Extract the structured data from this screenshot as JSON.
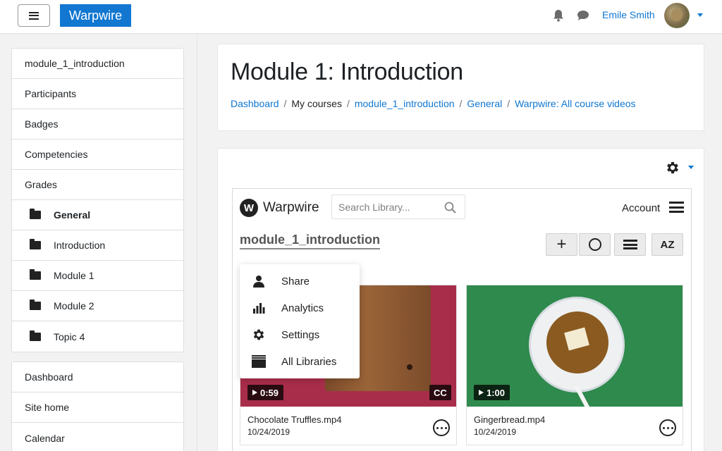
{
  "navbar": {
    "brand": "Warpwire",
    "user_name": "Emile Smith",
    "icons": [
      "menu-icon",
      "bell-icon",
      "chat-icon",
      "chevron-down-icon"
    ],
    "accent": "#1177d1"
  },
  "sidebar": {
    "course_items": [
      {
        "label": "module_1_introduction"
      },
      {
        "label": "Participants"
      },
      {
        "label": "Badges"
      },
      {
        "label": "Competencies"
      },
      {
        "label": "Grades"
      },
      {
        "label": "General"
      },
      {
        "label": "Introduction"
      },
      {
        "label": "Module 1"
      },
      {
        "label": "Module 2"
      },
      {
        "label": "Topic 4"
      }
    ],
    "site_items": [
      {
        "label": "Dashboard"
      },
      {
        "label": "Site home"
      },
      {
        "label": "Calendar"
      }
    ]
  },
  "header": {
    "title": "Module 1: Introduction",
    "breadcrumb": [
      "Dashboard",
      "My courses",
      "module_1_introduction",
      "General",
      "Warpwire: All course videos"
    ]
  },
  "warpwire": {
    "logo_letter": "W",
    "name": "Warpwire",
    "search_placeholder": "Search Library...",
    "account_label": "Account",
    "library_title": "module_1_introduction",
    "toolbar": {
      "add": "+",
      "az": "AZ"
    },
    "menu": [
      {
        "label": "Share",
        "icon": "person-icon"
      },
      {
        "label": "Analytics",
        "icon": "bar-chart-icon"
      },
      {
        "label": "Settings",
        "icon": "gear-icon"
      },
      {
        "label": "All Libraries",
        "icon": "library-icon"
      }
    ],
    "videos": [
      {
        "title": "Chocolate Truffles.mp4",
        "date": "10/24/2019",
        "duration": "0:59",
        "cc": "CC"
      },
      {
        "title": "Gingerbread.mp4",
        "date": "10/24/2019",
        "duration": "1:00"
      }
    ]
  }
}
